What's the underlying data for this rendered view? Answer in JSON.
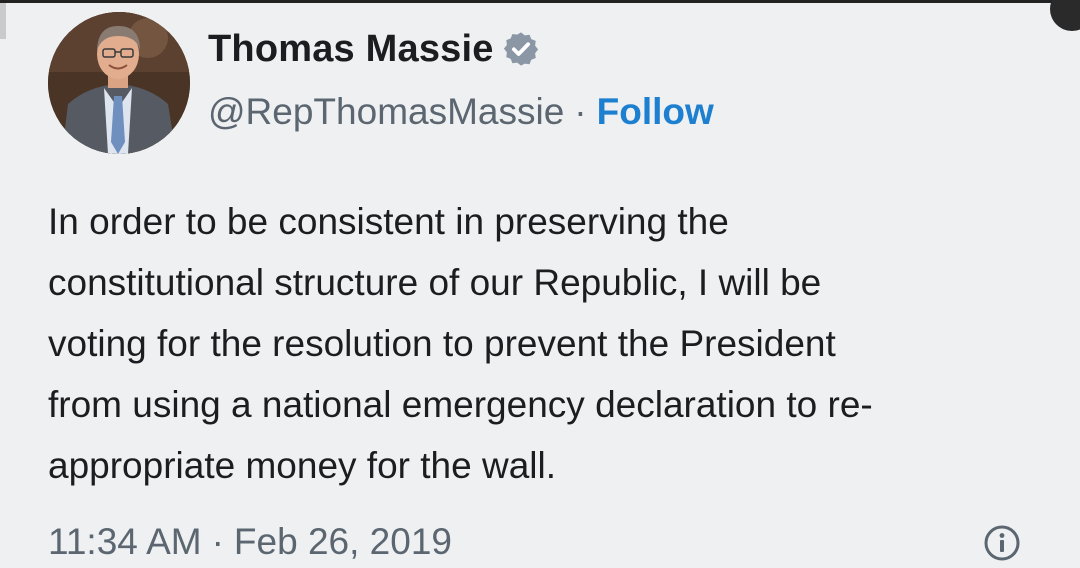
{
  "tweet": {
    "author": {
      "display_name": "Thomas Massie",
      "handle": "@RepThomasMassie",
      "verified": true,
      "avatar_icon": "profile-photo"
    },
    "separator": "·",
    "follow_label": "Follow",
    "body_lines": [
      "In order to be consistent in preserving the",
      "constitutional structure of our Republic, I will be",
      "voting for the resolution to prevent the President",
      "from using a national emergency declaration to re-",
      "appropriate money for the wall."
    ],
    "time": "11:34 AM",
    "date": "Feb 26, 2019",
    "info_icon": "info-icon",
    "colors": {
      "background": "#eef0f2",
      "text": "#1b1d20",
      "secondary_text": "#5b6670",
      "accent": "#1d7fcf",
      "verified_badge": "#8b97a5"
    }
  }
}
